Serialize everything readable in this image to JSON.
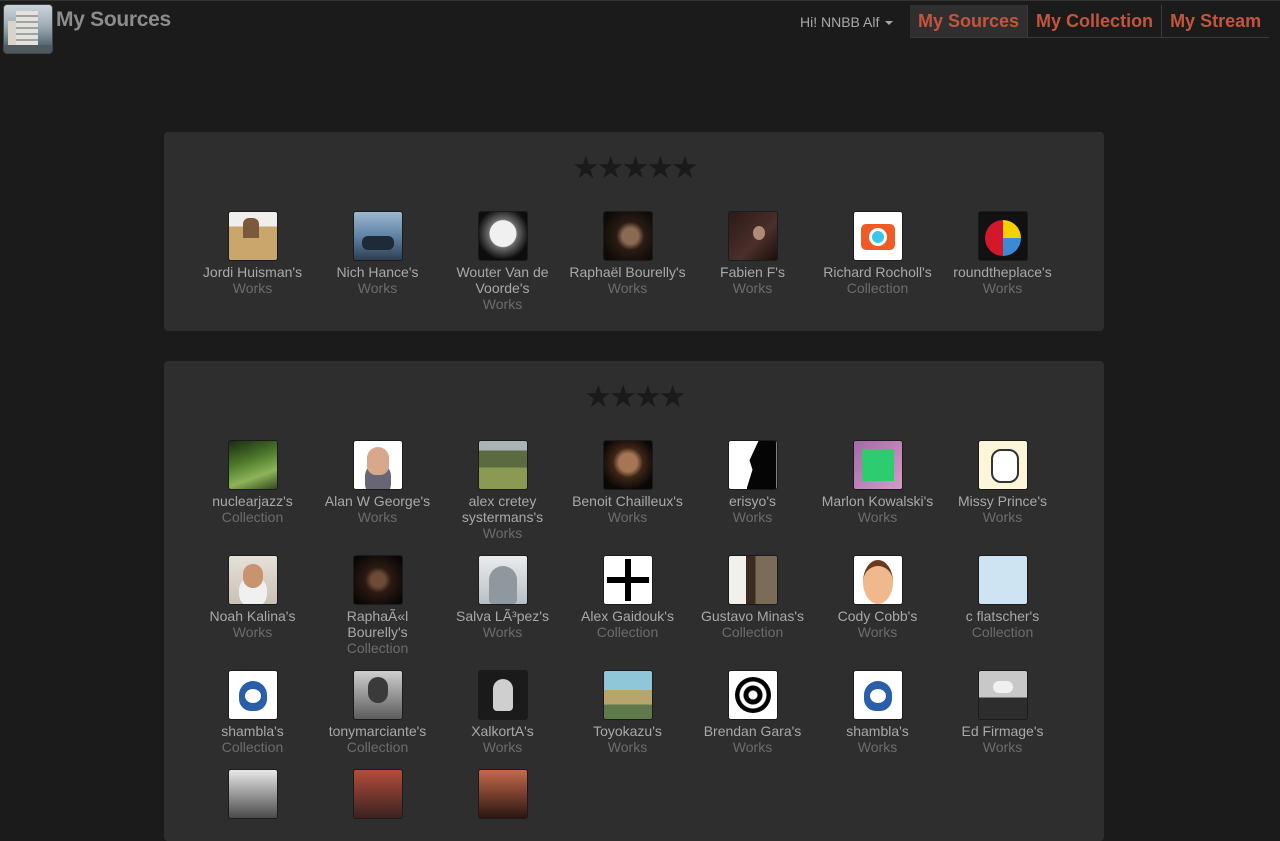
{
  "header": {
    "title": "My Sources",
    "user_menu_label": "Hi! NNBB Alf",
    "nav": [
      "My Sources",
      "My Collection",
      "My Stream"
    ]
  },
  "sections": [
    {
      "stars": "★★★★★",
      "items": [
        {
          "name": "Jordi Huisman's",
          "kind": "Works"
        },
        {
          "name": "Nich Hance's",
          "kind": "Works"
        },
        {
          "name": "Wouter Van de Voorde's",
          "kind": "Works"
        },
        {
          "name": "Raphaël Bourelly's",
          "kind": "Works"
        },
        {
          "name": "Fabien F's",
          "kind": "Works"
        },
        {
          "name": "Richard Rocholl's",
          "kind": "Collection"
        },
        {
          "name": "roundtheplace's",
          "kind": "Works"
        }
      ]
    },
    {
      "stars": "★★★★",
      "items": [
        {
          "name": "nuclearjazz's",
          "kind": "Collection"
        },
        {
          "name": "Alan W George's",
          "kind": "Works"
        },
        {
          "name": "alex cretey systermans's",
          "kind": "Works"
        },
        {
          "name": "Benoit Chailleux's",
          "kind": "Works"
        },
        {
          "name": "erisyo's",
          "kind": "Works"
        },
        {
          "name": "Marlon Kowalski's",
          "kind": "Works"
        },
        {
          "name": "Missy Prince's",
          "kind": "Works"
        },
        {
          "name": "Noah Kalina's",
          "kind": "Works"
        },
        {
          "name": "RaphaÃ«l Bourelly's",
          "kind": "Collection"
        },
        {
          "name": "Salva LÃ³pez's",
          "kind": "Works"
        },
        {
          "name": "Alex Gaidouk's",
          "kind": "Collection"
        },
        {
          "name": "Gustavo Minas's",
          "kind": "Collection"
        },
        {
          "name": "Cody Cobb's",
          "kind": "Works"
        },
        {
          "name": "c flatscher's",
          "kind": "Collection"
        },
        {
          "name": "shambla's",
          "kind": "Collection"
        },
        {
          "name": "tonymarciante's",
          "kind": "Collection"
        },
        {
          "name": "XalkortA's",
          "kind": "Works"
        },
        {
          "name": "Toyokazu's",
          "kind": "Works"
        },
        {
          "name": "Brendan Gara's",
          "kind": "Works"
        },
        {
          "name": "shambla's",
          "kind": "Works"
        },
        {
          "name": "Ed Firmage's",
          "kind": "Works"
        },
        {
          "name": "",
          "kind": ""
        },
        {
          "name": "",
          "kind": ""
        },
        {
          "name": "",
          "kind": ""
        }
      ]
    }
  ]
}
